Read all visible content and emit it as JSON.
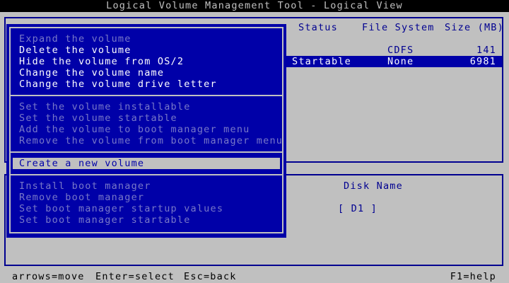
{
  "window": {
    "title": "Logical Volume Management Tool - Logical View"
  },
  "partition_table": {
    "columns": [
      "Status",
      "File System",
      "Size (MB)"
    ],
    "rows": [
      {
        "status": "",
        "file_system": "CDFS",
        "size": "141"
      },
      {
        "status": "Startable",
        "file_system": "None",
        "size": "6981"
      }
    ]
  },
  "disk_table": {
    "columns": [
      "Disk Name"
    ],
    "rows": [
      {
        "disk_name": "[ D1 ]"
      }
    ]
  },
  "menu": {
    "group1": [
      {
        "label": "Expand the volume",
        "enabled": false
      },
      {
        "label": "Delete the volume",
        "enabled": true
      },
      {
        "label": "Hide the volume from OS/2",
        "enabled": true
      },
      {
        "label": "Change the volume name",
        "enabled": true
      },
      {
        "label": "Change the volume drive letter",
        "enabled": true
      }
    ],
    "group2": [
      {
        "label": "Set the volume installable",
        "enabled": false
      },
      {
        "label": "Set the volume startable",
        "enabled": false
      },
      {
        "label": "Add the volume to boot manager menu",
        "enabled": false
      },
      {
        "label": "Remove the volume from boot manager menu",
        "enabled": false
      }
    ],
    "group3": [
      {
        "label": "Create a new volume",
        "enabled": true,
        "highlighted": true
      }
    ],
    "group4": [
      {
        "label": "Install boot manager",
        "enabled": false
      },
      {
        "label": "Remove boot manager",
        "enabled": false
      },
      {
        "label": "Set boot manager startup values",
        "enabled": false
      },
      {
        "label": "Set boot manager startable",
        "enabled": false
      }
    ]
  },
  "status_bar": {
    "arrows": "arrows=move",
    "enter": "Enter=select",
    "esc": "Esc=back",
    "help": "F1=help"
  },
  "colors": {
    "menu_bg": "#0000a8",
    "screen_bg": "#c0c0c0",
    "enabled_text": "#ffffff",
    "disabled_text": "#7878c8",
    "accent_text": "#000090"
  }
}
